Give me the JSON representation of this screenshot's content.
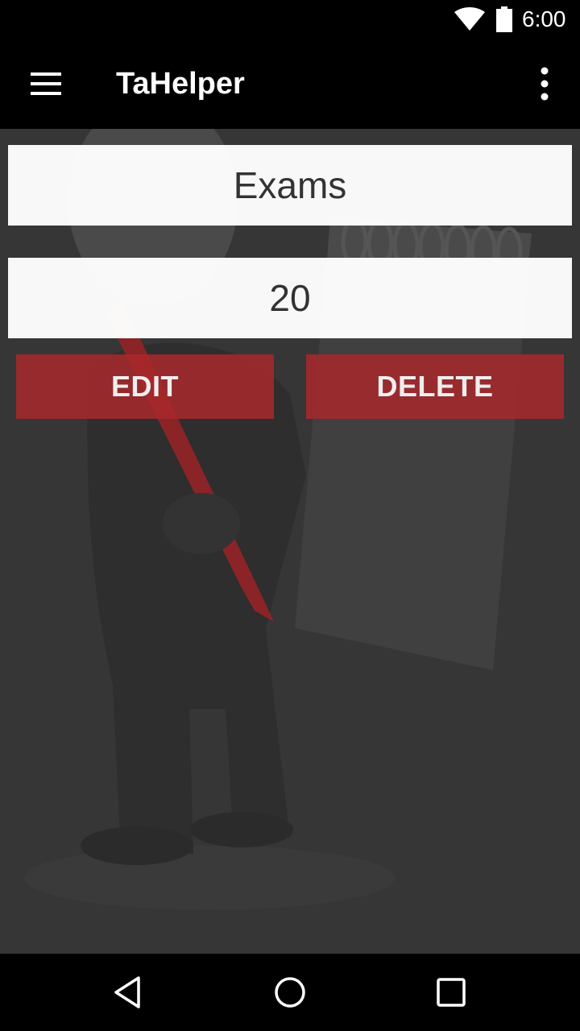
{
  "status_bar": {
    "time": "6:00",
    "icons": [
      "wifi-icon",
      "battery-icon"
    ]
  },
  "app_bar": {
    "title": "TaHelper",
    "icons": [
      "menu-icon",
      "overflow-menu-icon"
    ]
  },
  "detail": {
    "name": "Exams",
    "value": "20"
  },
  "actions": {
    "edit_label": "EDIT",
    "delete_label": "DELETE"
  },
  "nav_bar": {
    "icons": [
      "back-icon",
      "home-icon",
      "recent-apps-icon"
    ]
  },
  "colors": {
    "accent": "#a8282c",
    "background": "#363636",
    "bar": "#000000"
  }
}
